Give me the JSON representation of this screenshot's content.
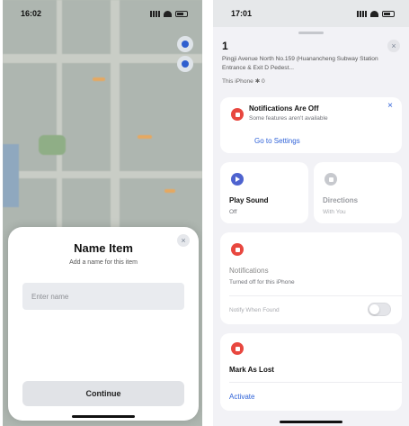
{
  "left": {
    "status": {
      "time": "16:02"
    },
    "sheet": {
      "title": "Name Item",
      "subtitle": "Add a name for this item",
      "input_placeholder": "Enter name",
      "continue_label": "Continue",
      "close_glyph": "×"
    }
  },
  "right": {
    "status": {
      "time": "17:01"
    },
    "item": {
      "name": "1",
      "address": "Pingji Avenue North No.159 (Huanancheng Subway Station Entrance & Exit D Pedest...",
      "location_note": "This iPhone ✱ 0"
    },
    "close_glyph": "×",
    "notifications_banner": {
      "title": "Notifications Are Off",
      "subtitle": "Some features aren't available",
      "link": "Go to Settings",
      "dismiss_glyph": "×"
    },
    "play_sound": {
      "title": "Play Sound",
      "status": "Off"
    },
    "directions": {
      "title": "Directions",
      "status": "With You"
    },
    "notifications": {
      "title": "Notifications",
      "subtitle": "Turned off for this iPhone",
      "toggle_label": "Notify When Found"
    },
    "lost": {
      "title": "Mark As Lost",
      "link": "Activate"
    }
  },
  "colors": {
    "accent": "#2f62d8",
    "alert": "#e8473f",
    "sound": "#4e63cf"
  }
}
